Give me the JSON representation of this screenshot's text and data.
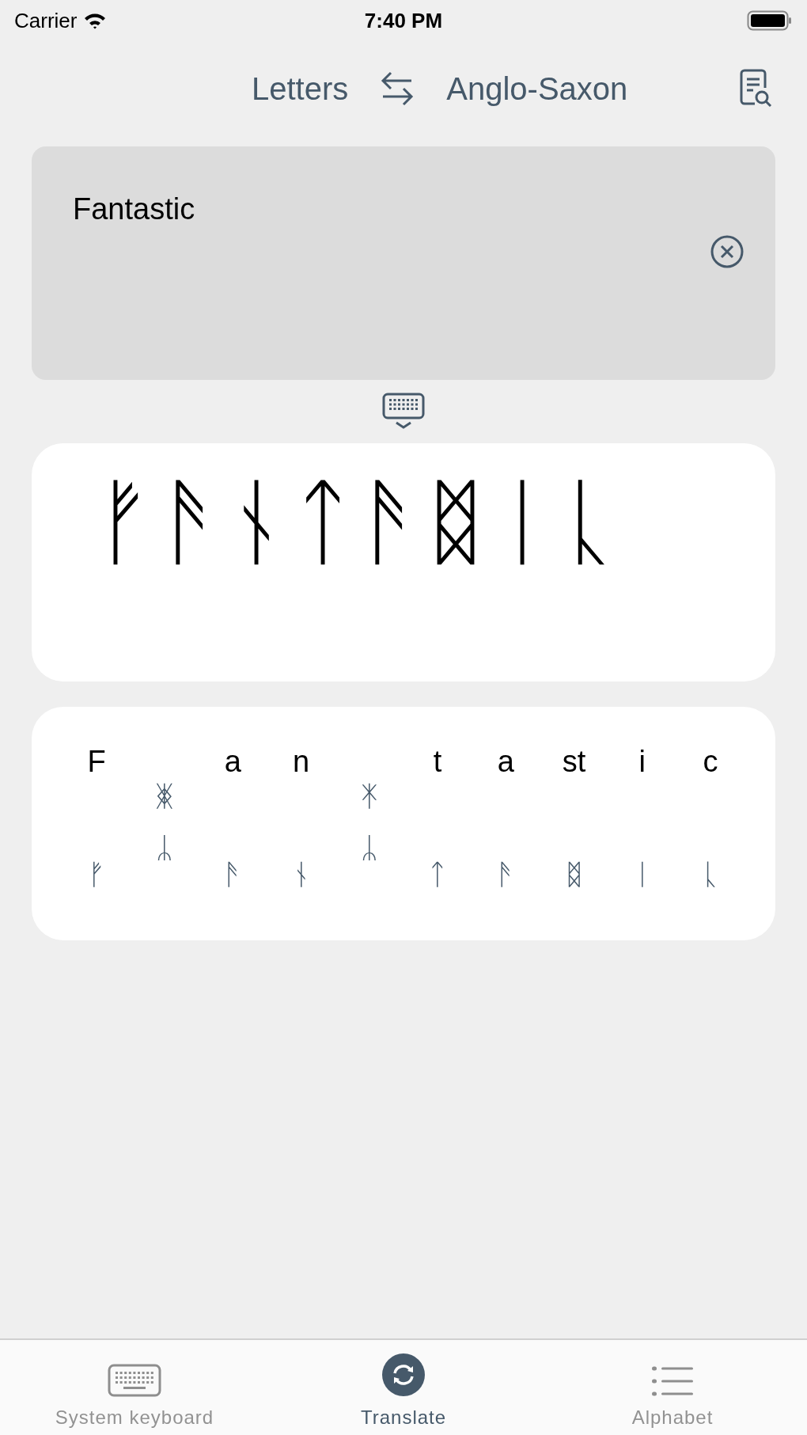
{
  "status_bar": {
    "carrier": "Carrier",
    "time": "7:40 PM"
  },
  "header": {
    "source": "Letters",
    "target": "Anglo-Saxon"
  },
  "input": {
    "value": "Fantastic"
  },
  "output": {
    "text": "ᚠᚫᚾᛏᚫᛥᛁᚳ"
  },
  "breakdown": [
    {
      "letter": "F",
      "runes": [
        "ᚠ"
      ]
    },
    {
      "runes": [
        "ᛤ",
        "ᛦ"
      ]
    },
    {
      "letter": "a",
      "runes": [
        "ᚫ"
      ]
    },
    {
      "letter": "n",
      "runes": [
        "ᚾ"
      ]
    },
    {
      "runes": [
        "ᛡ",
        "ᛦ"
      ]
    },
    {
      "letter": "t",
      "runes": [
        "ᛏ"
      ]
    },
    {
      "letter": "a",
      "runes": [
        "ᚫ"
      ]
    },
    {
      "letter": "st",
      "runes": [
        "ᛥ"
      ]
    },
    {
      "letter": "i",
      "runes": [
        "ᛁ"
      ]
    },
    {
      "letter": "c",
      "runes": [
        "ᚳ"
      ]
    }
  ],
  "tabs": [
    {
      "label": "System keyboard",
      "selected": false,
      "kind": "keyboard"
    },
    {
      "label": "Translate",
      "selected": true,
      "kind": "translate"
    },
    {
      "label": "Alphabet",
      "selected": false,
      "kind": "list"
    }
  ]
}
